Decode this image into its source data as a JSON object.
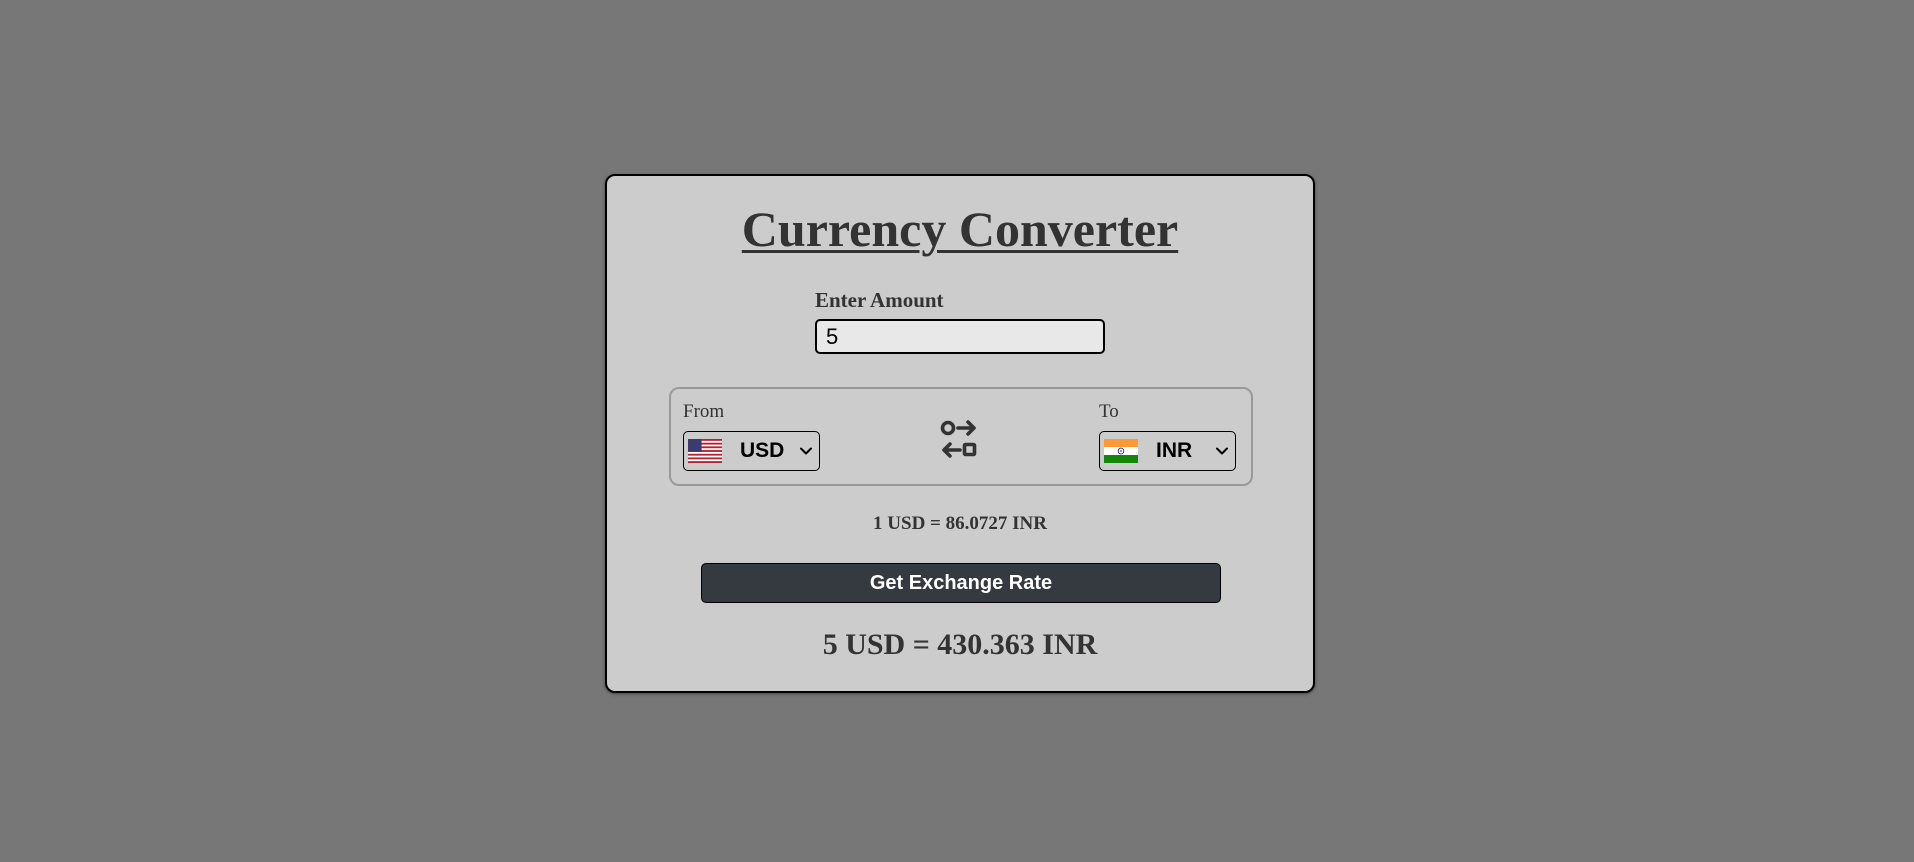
{
  "app": {
    "title": "Currency Converter"
  },
  "amount": {
    "label": "Enter Amount",
    "value": "5"
  },
  "from": {
    "label": "From",
    "currency": "USD",
    "flag_icon": "us-flag-icon"
  },
  "to": {
    "label": "To",
    "currency": "INR",
    "flag_icon": "india-flag-icon"
  },
  "swap": {
    "icon": "swap-arrows-icon"
  },
  "rate": {
    "message": "1 USD = 86.0727 INR"
  },
  "button": {
    "label": "Get Exchange Rate"
  },
  "result": {
    "text": "5 USD = 430.363 INR"
  },
  "colors": {
    "page_background": "#777777",
    "card_background": "#cccccc",
    "button_background": "#343a40",
    "text": "#333333"
  }
}
